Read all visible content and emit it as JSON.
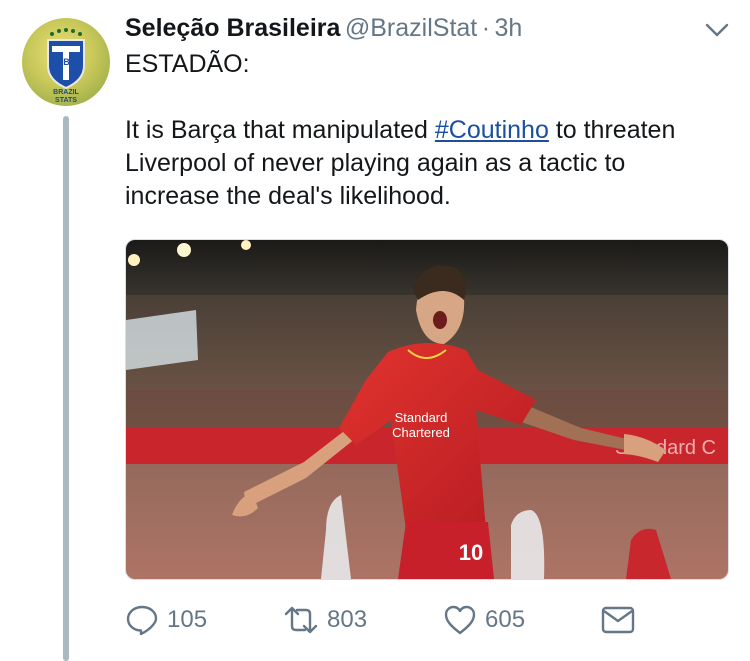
{
  "tweet": {
    "display_name": "Seleção Brasileira",
    "handle": "@BrazilStat",
    "separator": "·",
    "time": "3h",
    "text_line1": "ESTADÃO:",
    "text_before_tag": "It is Barça that manipulated ",
    "hashtag": "#Coutinho",
    "text_after_tag": " to threaten Liverpool of never playing again as a tactic to increase the deal's likelihood."
  },
  "avatar": {
    "badge_text": "CBF",
    "caption_line1": "BRAZIL",
    "caption_line2": "STATS"
  },
  "media": {
    "shirt_sponsor_line1": "Standard",
    "shirt_sponsor_line2": "Chartered",
    "shirt_number": "10",
    "hoarding_text": "Standard C"
  },
  "actions": {
    "replies": "105",
    "retweets": "803",
    "likes": "605"
  },
  "icons": [
    "chevron-down-icon",
    "reply-icon",
    "retweet-icon",
    "like-icon",
    "direct-message-icon"
  ],
  "colors": {
    "link": "#1b4fa0",
    "muted": "#657786",
    "thread_line": "#aab8c2",
    "kit_red": "#d8242c"
  }
}
